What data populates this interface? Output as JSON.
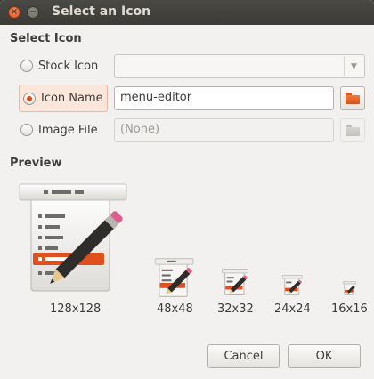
{
  "window": {
    "title": "Select an Icon",
    "close_glyph": "×",
    "minimize_glyph": "−"
  },
  "select_section": {
    "heading": "Select Icon",
    "options": [
      {
        "label": "Stock Icon",
        "checked": false
      },
      {
        "label": "Icon Name",
        "checked": true
      },
      {
        "label": "Image File",
        "checked": false
      }
    ],
    "stock_combo": {
      "value": "",
      "arrow_icon": "chevron-down-icon"
    },
    "icon_name_entry": {
      "value": "menu-editor"
    },
    "image_file_entry": {
      "value": "(None)"
    }
  },
  "preview_section": {
    "heading": "Preview",
    "icon_name": "menu-editor-icon",
    "sizes": [
      "128x128",
      "48x48",
      "32x32",
      "24x24",
      "16x16"
    ]
  },
  "buttons": {
    "cancel": "Cancel",
    "ok": "OK"
  },
  "colors": {
    "accent": "#df4a16",
    "titlebar": "#3c3b37",
    "background": "#f2f1f0"
  }
}
